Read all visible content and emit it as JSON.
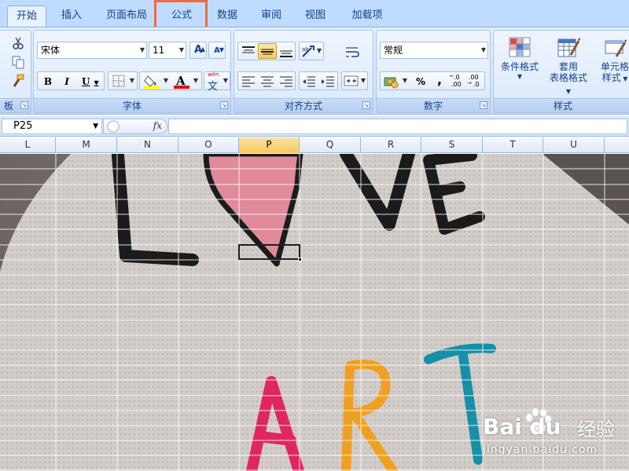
{
  "tabs": [
    {
      "label": "开始",
      "active": true
    },
    {
      "label": "插入"
    },
    {
      "label": "页面布局"
    },
    {
      "label": "公式",
      "highlighted": true
    },
    {
      "label": "数据"
    },
    {
      "label": "审阅"
    },
    {
      "label": "视图"
    },
    {
      "label": "加载项"
    }
  ],
  "clipboard": {
    "title_fragment": "板"
  },
  "font": {
    "title": "字体",
    "family": "宋体",
    "size": "11",
    "grow_label": "A",
    "shrink_label": "A",
    "bold": "B",
    "italic": "I",
    "underline": "U",
    "font_color_label": "A",
    "phonetic_top": "wén",
    "phonetic_char": "文"
  },
  "alignment": {
    "title": "对齐方式"
  },
  "number": {
    "title": "数字",
    "format": "常规",
    "percent": "%",
    "comma": ",",
    "inc_decimal": ".00",
    "dec_decimal": ".00"
  },
  "styles": {
    "title": "样式",
    "conditional_format": "条件格式",
    "table_format_line1": "套用",
    "table_format_line2": "表格格式",
    "cell_styles_line1": "单元格",
    "cell_styles_line2": "样式"
  },
  "formula_bar": {
    "name_box": "P25",
    "fx": "fx",
    "formula": ""
  },
  "columns": [
    "L",
    "M",
    "N",
    "O",
    "P",
    "Q",
    "R",
    "S",
    "T",
    "U"
  ],
  "selected_column": "P",
  "artwork": {
    "word_top": "LOVE",
    "word_bottom": "ART",
    "colors": {
      "ink": "#1b1b1b",
      "heart": "#e08a9a",
      "letter_a": "#e0265e",
      "letter_r": "#f0a020",
      "letter_t": "#1690a8",
      "fabric": "#d3cdca"
    }
  },
  "watermark": {
    "brand": "Bai du",
    "cn": "经验",
    "url": "jingyan.baidu.com"
  },
  "theme": {
    "ribbon_tab_bg": "#bfdbff",
    "highlight": "#f0693e",
    "selected_header": "#f8c95c"
  }
}
